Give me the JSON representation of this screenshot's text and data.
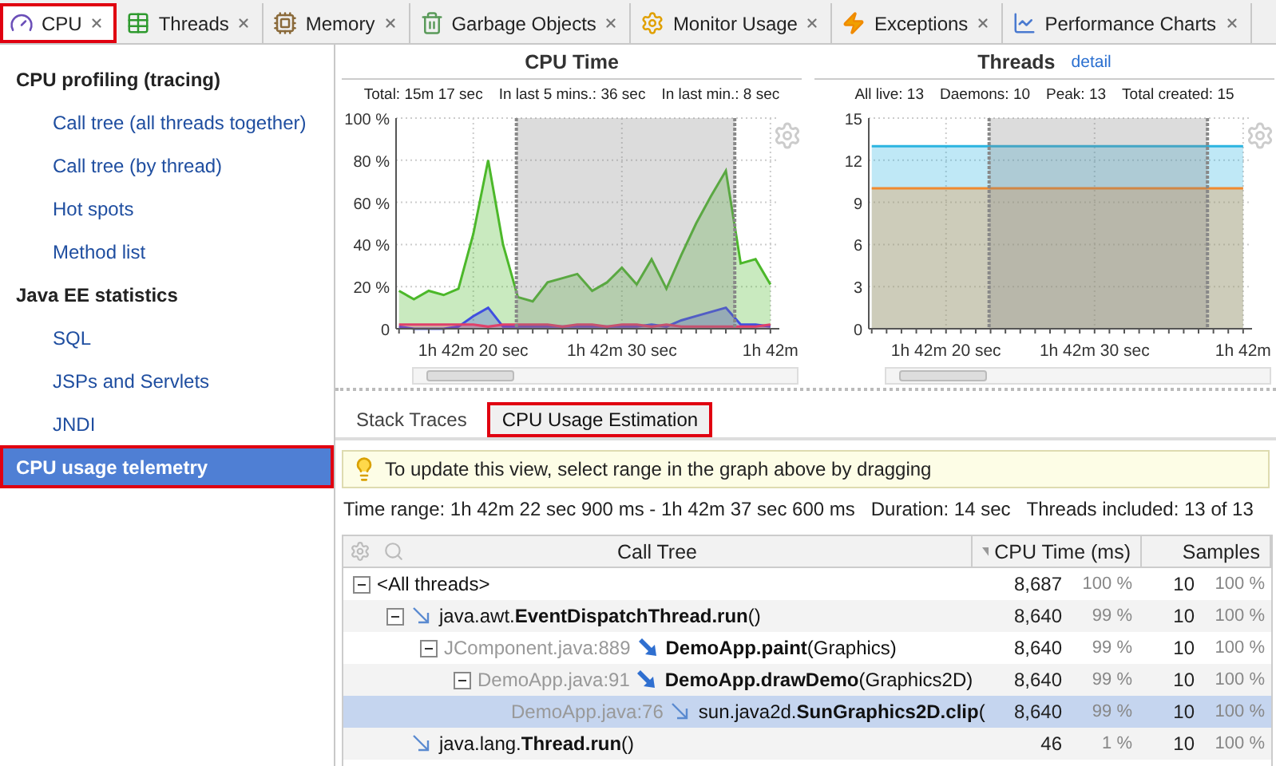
{
  "tabs": [
    {
      "label": "CPU",
      "selected": true,
      "highlighted": true
    },
    {
      "label": "Threads",
      "selected": false,
      "highlighted": false
    },
    {
      "label": "Memory",
      "selected": false,
      "highlighted": false
    },
    {
      "label": "Garbage Objects",
      "selected": false,
      "highlighted": false
    },
    {
      "label": "Monitor Usage",
      "selected": false,
      "highlighted": false
    },
    {
      "label": "Exceptions",
      "selected": false,
      "highlighted": false
    },
    {
      "label": "Performance Charts",
      "selected": false,
      "highlighted": false
    }
  ],
  "sidebar": {
    "sections": [
      {
        "title": "CPU profiling (tracing)",
        "selected": false,
        "highlighted": false,
        "items": [
          {
            "label": "Call tree (all threads together)",
            "selected": false
          },
          {
            "label": "Call tree (by thread)",
            "selected": false
          },
          {
            "label": "Hot spots",
            "selected": false
          },
          {
            "label": "Method list",
            "selected": false
          }
        ]
      },
      {
        "title": "Java EE statistics",
        "selected": false,
        "highlighted": false,
        "items": [
          {
            "label": "SQL",
            "selected": false
          },
          {
            "label": "JSPs and Servlets",
            "selected": false
          },
          {
            "label": "JNDI",
            "selected": false
          }
        ]
      },
      {
        "title": "CPU usage telemetry",
        "selected": true,
        "highlighted": true
      }
    ]
  },
  "charts": [
    {
      "title": "CPU Time",
      "stats": [
        "Total: 15m 17 sec",
        "In last 5 mins.: 36 sec",
        "In last min.: 8 sec"
      ],
      "chart_data": {
        "type": "area",
        "ylim": [
          0,
          100
        ],
        "categories": [
          null,
          null,
          null,
          null,
          null,
          "1h 42m 20 sec",
          null,
          null,
          null,
          null,
          null,
          null,
          null,
          null,
          null,
          "1h 42m 30 sec",
          null,
          null,
          null,
          null,
          null,
          null,
          null,
          null,
          null,
          "1h 42m"
        ],
        "series": [
          {
            "color": "#4cb82a",
            "values": [
              18,
              14,
              18,
              16,
              19,
              45,
              80,
              40,
              15,
              13,
              22,
              24,
              26,
              18,
              22,
              29,
              21,
              33,
              19,
              35,
              50,
              63,
              75,
              31,
              33,
              21
            ]
          },
          {
            "color": "#3f4fe0",
            "values": [
              1,
              0,
              0,
              0,
              1,
              6,
              10,
              1,
              1,
              1,
              1,
              1,
              1,
              1,
              1,
              1,
              1,
              2,
              1,
              4,
              6,
              8,
              10,
              2,
              2,
              1
            ]
          },
          {
            "color": "#e0406a",
            "values": [
              2,
              2,
              2,
              2,
              2,
              2,
              1,
              2,
              2,
              2,
              2,
              1,
              2,
              2,
              1,
              2,
              2,
              1,
              2,
              1,
              1,
              1,
              1,
              1,
              1,
              2
            ]
          }
        ],
        "yticks": [
          {
            "value": 0,
            "label": "0"
          },
          {
            "value": 20,
            "label": "20 %"
          },
          {
            "value": 40,
            "label": "40 %"
          },
          {
            "value": 60,
            "label": "60 %"
          },
          {
            "value": 80,
            "label": "80 %"
          },
          {
            "value": 100,
            "label": "100 %"
          }
        ],
        "grid": true
      }
    },
    {
      "title": "Threads",
      "link": "detail",
      "stats": [
        "All live: 13",
        "Daemons: 10",
        "Peak: 13",
        "Total created: 15"
      ],
      "chart_data": {
        "type": "area",
        "ylim": [
          0,
          15
        ],
        "categories": [
          null,
          null,
          null,
          null,
          null,
          "1h 42m 20 sec",
          null,
          null,
          null,
          null,
          null,
          null,
          null,
          null,
          null,
          "1h 42m 30 sec",
          null,
          null,
          null,
          null,
          null,
          null,
          null,
          null,
          null,
          "1h 42m"
        ],
        "series": [
          {
            "color": "#2bb4e0",
            "values": [
              13,
              13,
              13,
              13,
              13,
              13,
              13,
              13,
              13,
              13,
              13,
              13,
              13,
              13,
              13,
              13,
              13,
              13,
              13,
              13,
              13,
              13,
              13,
              13,
              13,
              13
            ]
          },
          {
            "color": "#f08a30",
            "values": [
              10,
              10,
              10,
              10,
              10,
              10,
              10,
              10,
              10,
              10,
              10,
              10,
              10,
              10,
              10,
              10,
              10,
              10,
              10,
              10,
              10,
              10,
              10,
              10,
              10,
              10
            ]
          }
        ],
        "yticks": [
          {
            "value": 0,
            "label": "0"
          },
          {
            "value": 3,
            "label": "3"
          },
          {
            "value": 6,
            "label": "6"
          },
          {
            "value": 9,
            "label": "9"
          },
          {
            "value": 12,
            "label": "12"
          },
          {
            "value": 15,
            "label": "15"
          }
        ],
        "grid": true
      }
    }
  ],
  "view_tabs": [
    {
      "label": "Stack Traces",
      "selected": false,
      "highlighted": false
    },
    {
      "label": "CPU Usage Estimation",
      "selected": true,
      "highlighted": true
    }
  ],
  "hint": "To update this view, select range in the graph above by dragging",
  "info": [
    "Time range: 1h 42m 22 sec 900 ms - 1h 42m 37 sec 600 ms",
    "Duration: 14 sec",
    "Threads included: 13 of 13"
  ],
  "table": {
    "columns": [
      "Call Tree",
      "CPU Time (ms)",
      "Samples"
    ],
    "rows": [
      {
        "kind": "root",
        "method": "<All threads>",
        "time": "8,687",
        "time_percent": "100 %",
        "samples": "10",
        "samples_percent": "100 %",
        "selected": false,
        "expanded": true,
        "children": [
          {
            "kind": "call",
            "method": "java.awt.**EventDispatchThread.run**()",
            "time": "8,640",
            "time_percent": "99 %",
            "samples": "10",
            "samples_percent": "100 %",
            "selected": false,
            "expanded": true,
            "children": [
              {
                "kind": "hot",
                "location": "JComponent.java:889",
                "method": "**DemoApp.paint**(Graphics)",
                "time": "8,640",
                "time_percent": "99 %",
                "samples": "10",
                "samples_percent": "100 %",
                "selected": false,
                "expanded": true,
                "children": [
                  {
                    "kind": "hot",
                    "location": "DemoApp.java:91",
                    "method": "**DemoApp.drawDemo**(Graphics2D)",
                    "time": "8,640",
                    "time_percent": "99 %",
                    "samples": "10",
                    "samples_percent": "100 %",
                    "selected": false,
                    "expanded": true,
                    "children": [
                      {
                        "kind": "call",
                        "location": "DemoApp.java:76",
                        "method": "sun.java2d.**SunGraphics2D.clip**(",
                        "time": "8,640",
                        "time_percent": "99 %",
                        "samples": "10",
                        "samples_percent": "100 %",
                        "selected": true
                      }
                    ]
                  }
                ]
              }
            ]
          },
          {
            "kind": "call",
            "method": "java.lang.**Thread.run**()",
            "time": "46",
            "time_percent": "1 %",
            "samples": "10",
            "samples_percent": "100 %",
            "selected": false
          }
        ]
      }
    ]
  }
}
